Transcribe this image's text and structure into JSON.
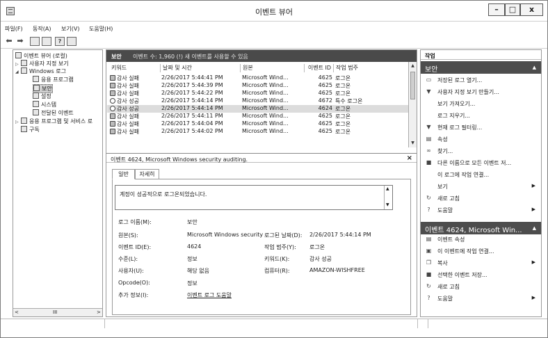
{
  "window": {
    "title": "이벤트 뷰어"
  },
  "menu": [
    "파일(F)",
    "동작(A)",
    "보기(V)",
    "도움말(H)"
  ],
  "tree": {
    "items": [
      {
        "label": "이벤트 뷰어 (로컬)"
      },
      {
        "label": "사용자 지정 보기"
      },
      {
        "label": "Windows 로그"
      },
      {
        "label": "응용 프로그램"
      },
      {
        "label": "보안"
      },
      {
        "label": "설정"
      },
      {
        "label": "시스템"
      },
      {
        "label": "전달된 이벤트"
      },
      {
        "label": "응용 프로그램 및 서비스 로"
      },
      {
        "label": "구독"
      }
    ],
    "hscroll_thumb": "III"
  },
  "list": {
    "title": "보안",
    "info": "이벤트 수: 1,960 (!) 새 이벤트를 사용할 수 있음",
    "columns": [
      "키워드",
      "날짜 및 시간",
      "원본",
      "이벤트 ID",
      "작업 범주"
    ],
    "rows": [
      {
        "icon": "lock-icon",
        "keyword": "감사 실패",
        "date": "2/26/2017 5:44:41 PM",
        "source": "Microsoft Wind...",
        "id": "4625",
        "category": "로그온"
      },
      {
        "icon": "lock-icon",
        "keyword": "감사 실패",
        "date": "2/26/2017 5:44:39 PM",
        "source": "Microsoft Wind...",
        "id": "4625",
        "category": "로그온"
      },
      {
        "icon": "lock-icon",
        "keyword": "감사 실패",
        "date": "2/26/2017 5:44:22 PM",
        "source": "Microsoft Wind...",
        "id": "4625",
        "category": "로그온"
      },
      {
        "icon": "key-icon",
        "keyword": "감사 성공",
        "date": "2/26/2017 5:44:14 PM",
        "source": "Microsoft Wind...",
        "id": "4672",
        "category": "특수 로그온"
      },
      {
        "icon": "key-icon",
        "keyword": "감사 성공",
        "date": "2/26/2017 5:44:14 PM",
        "source": "Microsoft Wind...",
        "id": "4624",
        "category": "로그온"
      },
      {
        "icon": "lock-icon",
        "keyword": "감사 실패",
        "date": "2/26/2017 5:44:11 PM",
        "source": "Microsoft Wind...",
        "id": "4625",
        "category": "로그온"
      },
      {
        "icon": "lock-icon",
        "keyword": "감사 실패",
        "date": "2/26/2017 5:44:04 PM",
        "source": "Microsoft Wind...",
        "id": "4625",
        "category": "로그온"
      },
      {
        "icon": "lock-icon",
        "keyword": "감사 실패",
        "date": "2/26/2017 5:44:02 PM",
        "source": "Microsoft Wind...",
        "id": "4625",
        "category": "로그온"
      }
    ],
    "selected_row": 4
  },
  "detail": {
    "header": "이벤트 4624, Microsoft Windows security auditing.",
    "tabs": [
      "일반",
      "자세히"
    ],
    "message": "계정이 성공적으로 로그온되었습니다.",
    "fields": {
      "log_name_label": "로그 이름(M):",
      "log_name": "보안",
      "source_label": "원본(S):",
      "source": "Microsoft Windows security",
      "logged_label": "로그된 날짜(D):",
      "logged": "2/26/2017 5:44:14 PM",
      "event_id_label": "이벤트 ID(E):",
      "event_id": "4624",
      "task_label": "작업 범주(Y):",
      "task": "로그온",
      "level_label": "수준(L):",
      "level": "정보",
      "keywords_label": "키워드(K):",
      "keywords": "감사 성공",
      "user_label": "사용자(U):",
      "user": "해당 없음",
      "computer_label": "컴퓨터(R):",
      "computer": "AMAZON-WISHFREE",
      "opcode_label": "Opcode(O):",
      "opcode": "정보",
      "more_label": "추가 정보(I):",
      "more_link": "이벤트 로그 도움말"
    }
  },
  "actions": {
    "header": "작업",
    "section1": "보안",
    "items1": [
      {
        "icon": "folder-icon",
        "label": "저장된 로그 열기..."
      },
      {
        "icon": "filter-icon",
        "label": "사용자 지정 보기 만들기..."
      },
      {
        "icon": "",
        "label": "보기 가져오기..."
      },
      {
        "icon": "",
        "label": "로그 지우기..."
      },
      {
        "icon": "filter-icon",
        "label": "현재 로그 필터링..."
      },
      {
        "icon": "properties-icon",
        "label": "속성"
      },
      {
        "icon": "binoculars-icon",
        "label": "찾기..."
      },
      {
        "icon": "save-icon",
        "label": "다른 이름으로 모든 이벤트 저..."
      },
      {
        "icon": "",
        "label": "이 로그에 작업 연결..."
      },
      {
        "icon": "",
        "label": "보기"
      },
      {
        "icon": "refresh-icon",
        "label": "새로 고침"
      },
      {
        "icon": "help-icon",
        "label": "도움말"
      }
    ],
    "section2": "이벤트 4624, Microsoft Win...",
    "items2": [
      {
        "icon": "properties-icon",
        "label": "이벤트 속성"
      },
      {
        "icon": "task-icon",
        "label": "이 이벤트에 작업 연결..."
      },
      {
        "icon": "copy-icon",
        "label": "복사"
      },
      {
        "icon": "save-icon",
        "label": "선택한 이벤트 저장..."
      },
      {
        "icon": "refresh-icon",
        "label": "새로 고침"
      },
      {
        "icon": "help-icon",
        "label": "도움말"
      }
    ]
  }
}
